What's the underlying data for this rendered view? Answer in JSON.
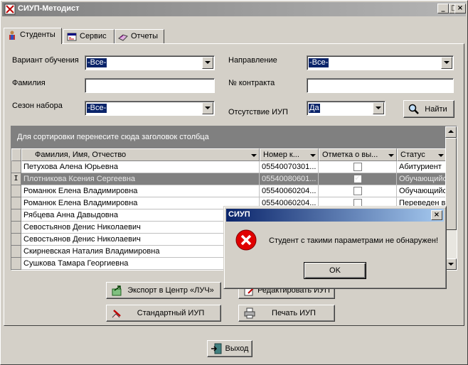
{
  "window": {
    "title": "СИУП-Методист",
    "minimize": "_",
    "maximize": "□",
    "close": "×"
  },
  "tabs": [
    {
      "label": "Студенты",
      "icon": "students-icon",
      "active": true
    },
    {
      "label": "Сервис",
      "icon": "service-icon",
      "active": false
    },
    {
      "label": "Отчеты",
      "icon": "reports-icon",
      "active": false
    }
  ],
  "filters": {
    "study_variant": {
      "label": "Вариант обучения",
      "value": "-Все-"
    },
    "direction": {
      "label": "Направление",
      "value": "-Все-"
    },
    "surname": {
      "label": "Фамилия",
      "value": ""
    },
    "contract": {
      "label": "№ контракта",
      "value": ""
    },
    "season": {
      "label": "Сезон набора",
      "value": "-Все-"
    },
    "no_iup": {
      "label": "Отсутствие ИУП",
      "value": "Да"
    },
    "find_button": "Найти"
  },
  "grid": {
    "group_hint": "Для сортировки перенесите сюда заголовок  столбца",
    "columns": [
      "Фамилия, Имя, Отчество",
      "Номер к...",
      "Отметка о вы...",
      "Статус"
    ],
    "rows": [
      {
        "name": "Петухова Алена Юрьевна",
        "number": "05540070301...",
        "checked": false,
        "status": "Абитуриент",
        "selected": false
      },
      {
        "name": "Плотникова Ксения   Сергеевна",
        "number": "05540080601...",
        "checked": true,
        "status": "Обучающийс...",
        "selected": true
      },
      {
        "name": "Романюк Елена  Владимировна",
        "number": "05540060204...",
        "checked": false,
        "status": "Обучающийс...",
        "selected": false
      },
      {
        "name": "Романюк Елена  Владимировна",
        "number": "05540060204...",
        "checked": false,
        "status": "Переведен  в...",
        "selected": false
      },
      {
        "name": "Рябцева Анна  Давыдовна",
        "number": "",
        "checked": false,
        "status": "",
        "selected": false
      },
      {
        "name": "Севостьянов Денис Николаевич",
        "number": "",
        "checked": false,
        "status": "",
        "selected": false
      },
      {
        "name": "Севостьянов Денис Николаевич",
        "number": "",
        "checked": false,
        "status": "",
        "selected": false
      },
      {
        "name": "Скирневская Наталия Владимировна",
        "number": "",
        "checked": false,
        "status": "",
        "selected": false
      },
      {
        "name": "Сушкова Тамара Георгиевна",
        "number": "",
        "checked": false,
        "status": "",
        "selected": false
      }
    ],
    "row_indicator": "I"
  },
  "actions": {
    "export": "Экспорт в Центр «ЛУЧ»",
    "edit": "Редактировать ИУП",
    "standard": "Стандартный ИУП",
    "print": "Печать ИУП",
    "exit": "Выход"
  },
  "dialog": {
    "title": "СИУП",
    "close": "×",
    "message": "Студент с такими параметрами не обнаружен!",
    "ok": "OK",
    "icon": "error-icon"
  },
  "colors": {
    "selection": "#0a246a",
    "face": "#d4d0c8",
    "selected_row": "#808080"
  }
}
